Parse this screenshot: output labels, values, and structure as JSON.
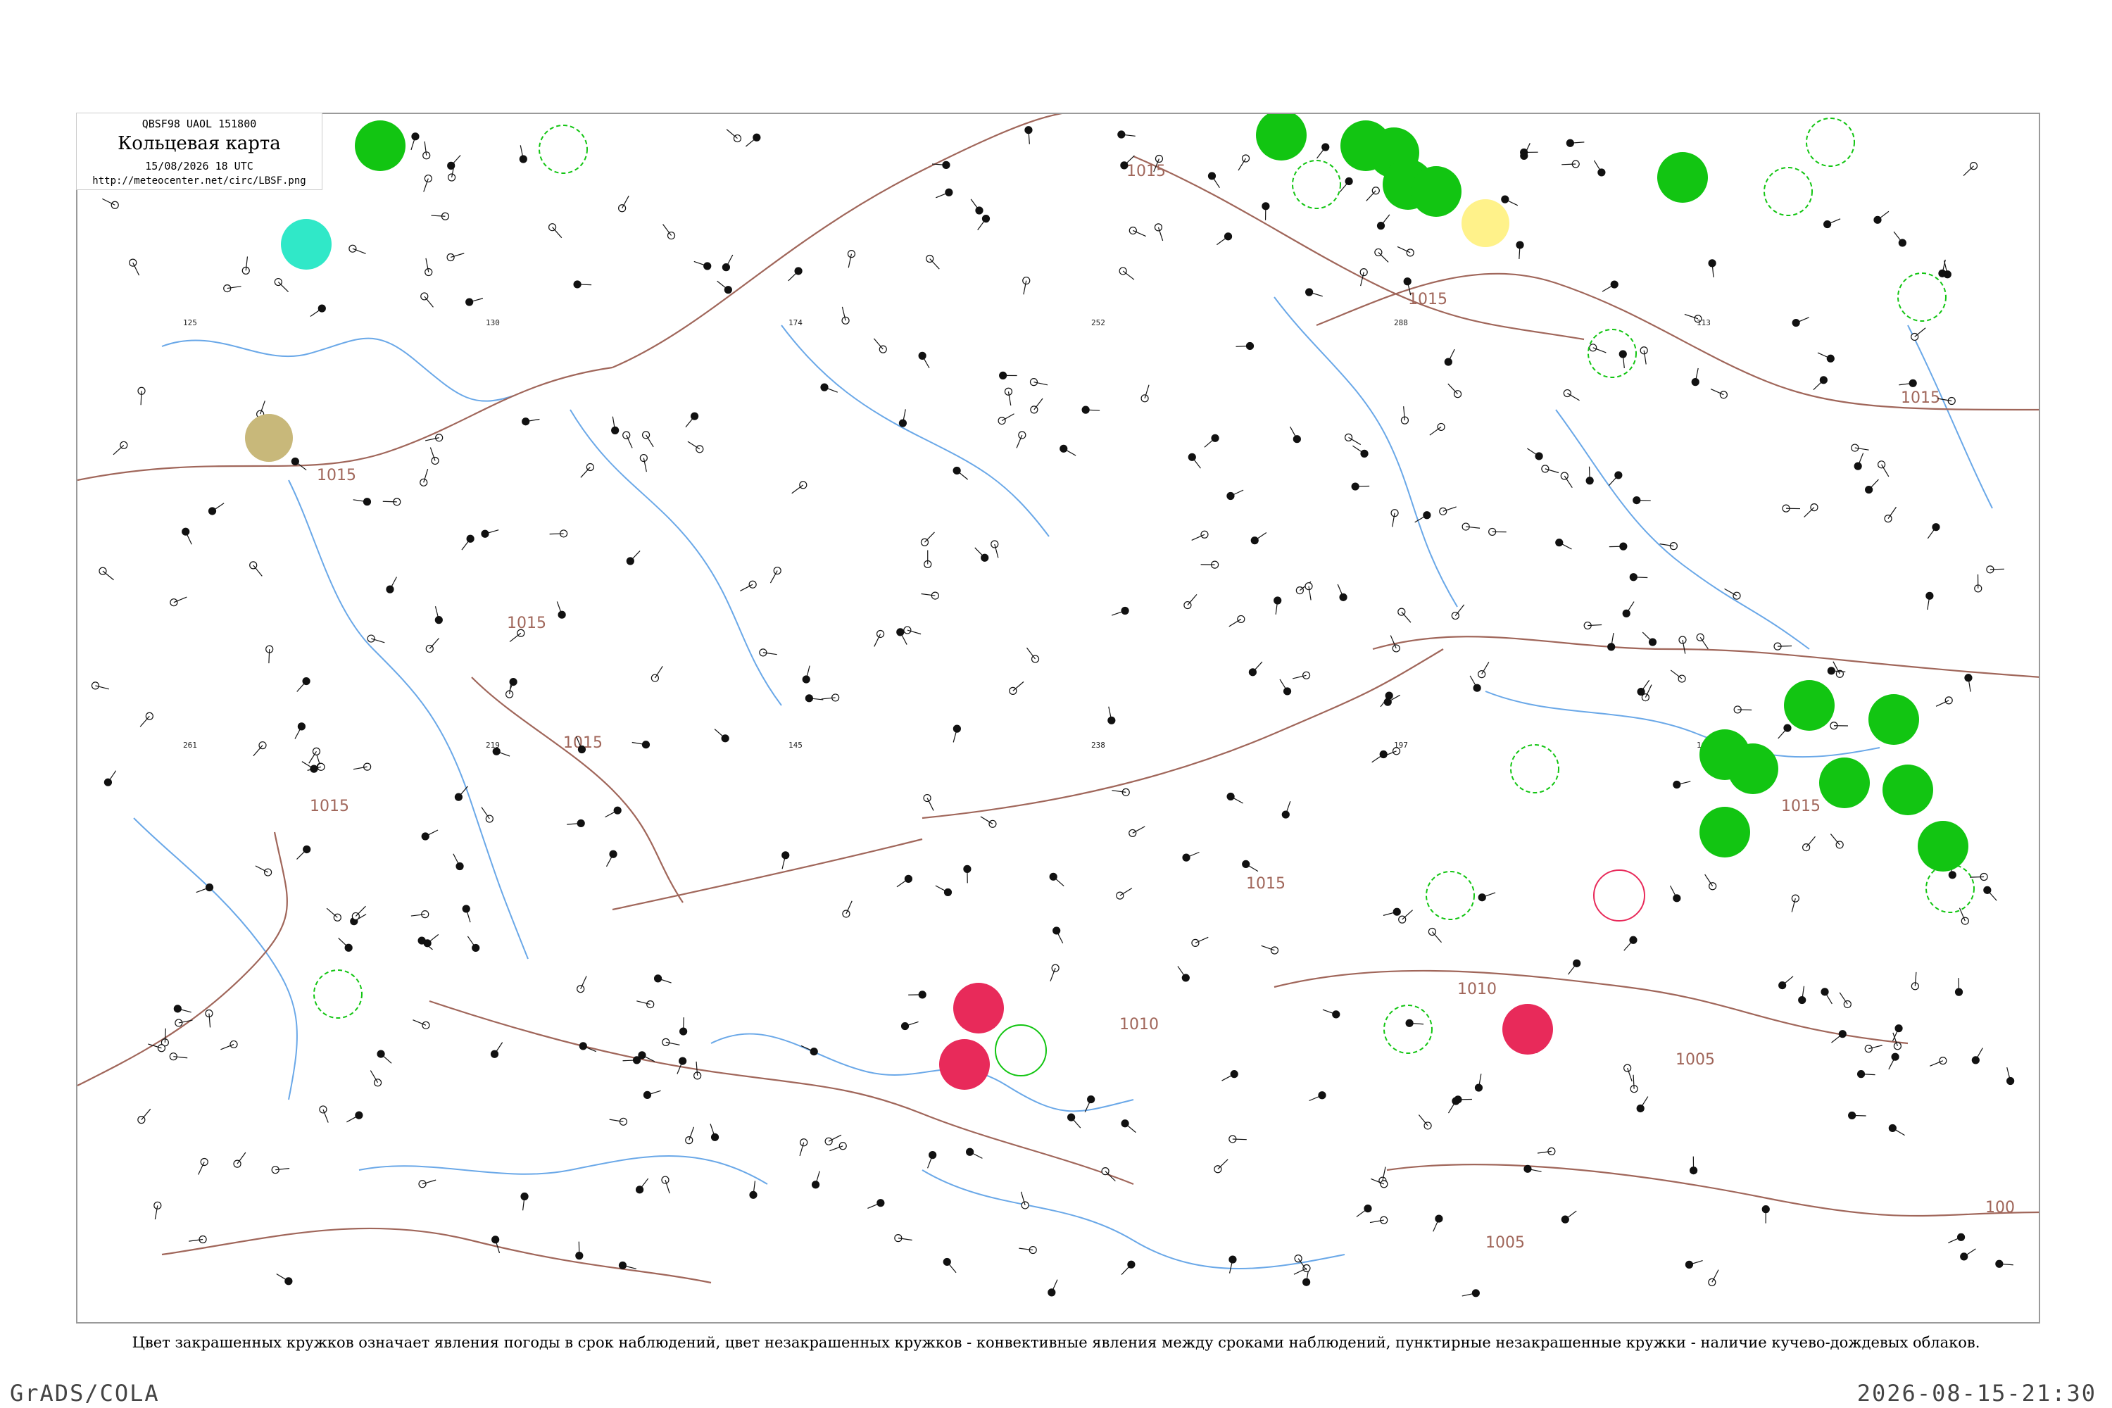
{
  "header": {
    "code": "QBSF98 UAOL 151800",
    "title": "Кольцевая карта",
    "date": "15/08/2026 18 UTC",
    "url": "http://meteocenter.net/circ/LBSF.png"
  },
  "caption": "Цвет закрашенных кружков означает явления погоды в срок наблюдений, цвет незакрашенных кружков - конвективные явления между сроками наблюдений, пунктирные незакрашенные кружки - наличие кучево-дождевых облаков.",
  "footer": {
    "left": "GrADS/COLA",
    "right": "2026-08-15-21:30"
  },
  "colors": {
    "isobar": "#a0665a",
    "water": "#6aa8e8",
    "rain": "#12c512",
    "thunderstorm": "#e82a5a",
    "shower": "#30e8c8",
    "haze": "#c8b87a",
    "fog": "#fff28a",
    "frame": "#9a9a9a"
  },
  "isobars": [
    {
      "label": "1015"
    },
    {
      "label": "1015"
    },
    {
      "label": "1015"
    },
    {
      "label": "1015"
    },
    {
      "label": "1015"
    },
    {
      "label": "1015"
    },
    {
      "label": "1015"
    },
    {
      "label": "1015"
    },
    {
      "label": "1015"
    },
    {
      "label": "1010"
    },
    {
      "label": "1010"
    },
    {
      "label": "1005"
    },
    {
      "label": "1005"
    },
    {
      "label": "100"
    }
  ],
  "stations": [
    {
      "id": "25",
      "value": "125"
    },
    {
      "id": "30",
      "value": "130"
    },
    {
      "id": "74",
      "value": "174"
    },
    {
      "id": "52",
      "value": "252"
    },
    {
      "id": "88",
      "value": "288"
    },
    {
      "id": "13",
      "value": "113"
    },
    {
      "id": "61",
      "value": "261"
    },
    {
      "id": "19",
      "value": "219"
    },
    {
      "id": "45",
      "value": "145"
    },
    {
      "id": "38",
      "value": "238"
    },
    {
      "id": "97",
      "value": "197"
    },
    {
      "id": "64",
      "value": "164"
    }
  ]
}
